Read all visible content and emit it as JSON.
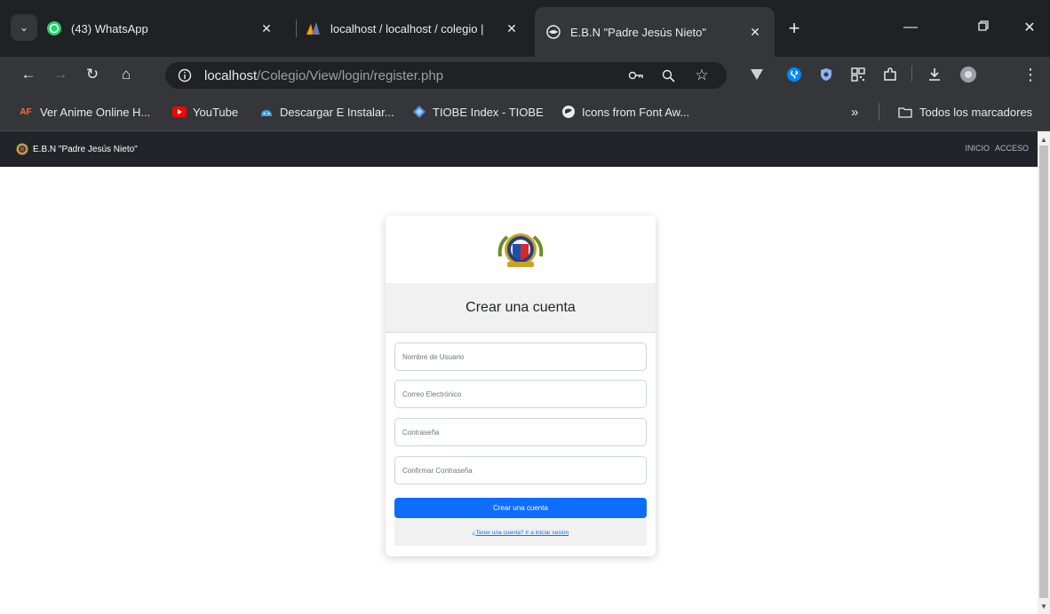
{
  "browser": {
    "tabs": [
      {
        "title": "(43) WhatsApp",
        "icon": "whatsapp-icon"
      },
      {
        "title": "localhost / localhost / colegio |",
        "icon": "phpmyadmin-icon"
      },
      {
        "title": "E.B.N \"Padre Jesús Nieto\"",
        "icon": "globe-icon"
      }
    ],
    "url_host": "localhost",
    "url_path": "/Colegio/View/login/register.php",
    "bookmarks": [
      {
        "label": "Ver Anime Online H...",
        "icon_text": "AF"
      },
      {
        "label": "YouTube"
      },
      {
        "label": "Descargar E Instalar..."
      },
      {
        "label": "TIOBE Index - TIOBE"
      },
      {
        "label": "Icons from Font Aw..."
      }
    ],
    "all_bookmarks_label": "Todos los marcadores"
  },
  "navbar": {
    "brand": "E.B.N \"Padre Jesús Nieto\"",
    "links": [
      "INICIO",
      "ACCESO"
    ]
  },
  "form": {
    "title": "Crear una cuenta",
    "username_placeholder": "Nombre de Usuario",
    "email_placeholder": "Correo Electrónico",
    "password_placeholder": "Contraseña",
    "confirm_placeholder": "Confirmar Contraseña",
    "submit_label": "Crear una cuenta",
    "login_link": "¿Tener una cuenta? Ir a iniciar sesión"
  },
  "colors": {
    "primary": "#0d6efd",
    "navbar": "#212529",
    "chrome": "#202124"
  }
}
